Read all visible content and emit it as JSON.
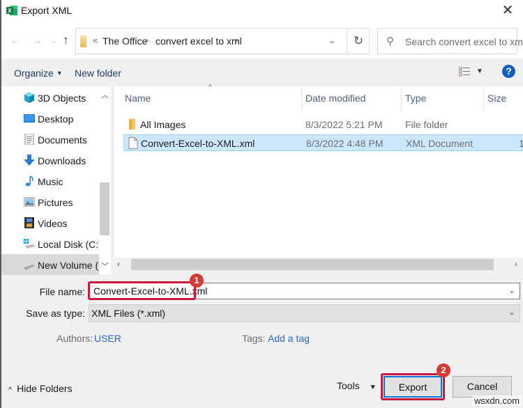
{
  "window": {
    "title": "Export XML",
    "app_icon": "excel-icon",
    "close_icon": "close-icon"
  },
  "nav": {
    "back_icon": "arrow-left-icon",
    "forward_icon": "arrow-right-icon",
    "recent_icon": "chevron-down-icon",
    "up_icon": "arrow-up-icon",
    "breadcrumb_overflow": "«",
    "breadcrumbs": [
      "The Office",
      "convert excel to xml"
    ],
    "refresh_icon": "refresh-icon",
    "search_placeholder": "Search convert excel to xml"
  },
  "toolbar": {
    "organize_label": "Organize",
    "new_folder_label": "New folder",
    "view_icon": "details-view-icon",
    "help_label": "?"
  },
  "sidebar": {
    "items": [
      {
        "label": "3D Objects",
        "icon": "3d-objects-icon"
      },
      {
        "label": "Desktop",
        "icon": "desktop-icon"
      },
      {
        "label": "Documents",
        "icon": "documents-icon"
      },
      {
        "label": "Downloads",
        "icon": "downloads-icon"
      },
      {
        "label": "Music",
        "icon": "music-icon"
      },
      {
        "label": "Pictures",
        "icon": "pictures-icon"
      },
      {
        "label": "Videos",
        "icon": "videos-icon"
      },
      {
        "label": "Local Disk (C:)",
        "icon": "local-disk-icon"
      },
      {
        "label": "New Volume (D:)",
        "icon": "drive-icon",
        "selected": true
      }
    ]
  },
  "filelist": {
    "columns": [
      "Name",
      "Date modified",
      "Type",
      "Size"
    ],
    "rows": [
      {
        "name": "All Images",
        "date": "8/3/2022 5:21 PM",
        "type": "File folder",
        "size": "",
        "icon": "folder-icon",
        "selected": false
      },
      {
        "name": "Convert-Excel-to-XML.xml",
        "date": "8/3/2022 4:48 PM",
        "type": "XML Document",
        "size": "1",
        "icon": "file-icon",
        "selected": true
      }
    ]
  },
  "form": {
    "file_name_label": "File name:",
    "file_name_value": "Convert-Excel-to-XML.xml",
    "save_type_label": "Save as type:",
    "save_type_value": "XML Files (*.xml)",
    "authors_label": "Authors:",
    "authors_value": "USER",
    "tags_label": "Tags:",
    "tags_value": "Add a tag"
  },
  "footer": {
    "hide_folders_label": "Hide Folders",
    "tools_label": "Tools",
    "export_label": "Export",
    "cancel_label": "Cancel"
  },
  "annotations": {
    "step1": "1",
    "step2": "2",
    "highlight_color": "#c8183e",
    "badge_color": "#d63a35"
  },
  "watermark": "wsxdn.com"
}
